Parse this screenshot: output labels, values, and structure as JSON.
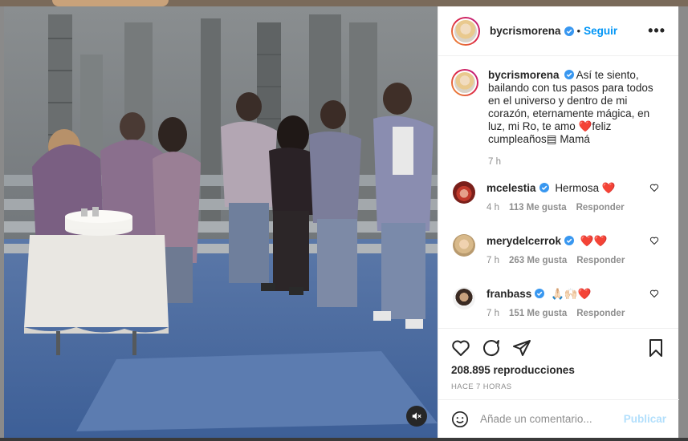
{
  "post": {
    "username": "bycrismorena",
    "follow_label": "Seguir",
    "more_label": "•••",
    "separator": "•"
  },
  "caption": {
    "text_before_heart": "Así te siento, bailando con tus pasos para todos en el universo y dentro de mi corazón, eternamente mágica, en luz, mi Ro, te amo ",
    "heart": "❤️",
    "text_after_heart": "feliz cumpleaños",
    "emoji_2": "▤",
    "text_end": " Mamá",
    "time": "7 h"
  },
  "comments": [
    {
      "user": "mcelestia",
      "text": "Hermosa ",
      "emoji": "❤️",
      "time": "4 h",
      "likes": "113 Me gusta",
      "reply": "Responder"
    },
    {
      "user": "merydelcerrok",
      "text": "",
      "emoji": "❤️❤️",
      "time": "7 h",
      "likes": "263 Me gusta",
      "reply": "Responder"
    },
    {
      "user": "franbass",
      "text": "🙏🏻🙌🏻",
      "emoji": "❤️",
      "time": "7 h",
      "likes": "151 Me gusta",
      "reply": "Responder"
    }
  ],
  "stats": {
    "views": "208.895 reproducciones",
    "time_ago": "HACE 7 HORAS"
  },
  "add_comment": {
    "placeholder": "Añade un comentario...",
    "post_label": "Publicar"
  },
  "colors": {
    "link_blue": "#0095f6",
    "verified_blue": "#3897f0",
    "heart_red": "#e0245e",
    "muted_text": "#8e8e8e"
  },
  "icons": [
    "verified-icon",
    "heart-icon",
    "comment-icon",
    "share-icon",
    "bookmark-icon",
    "emoji-icon",
    "mute-icon",
    "more-icon"
  ]
}
